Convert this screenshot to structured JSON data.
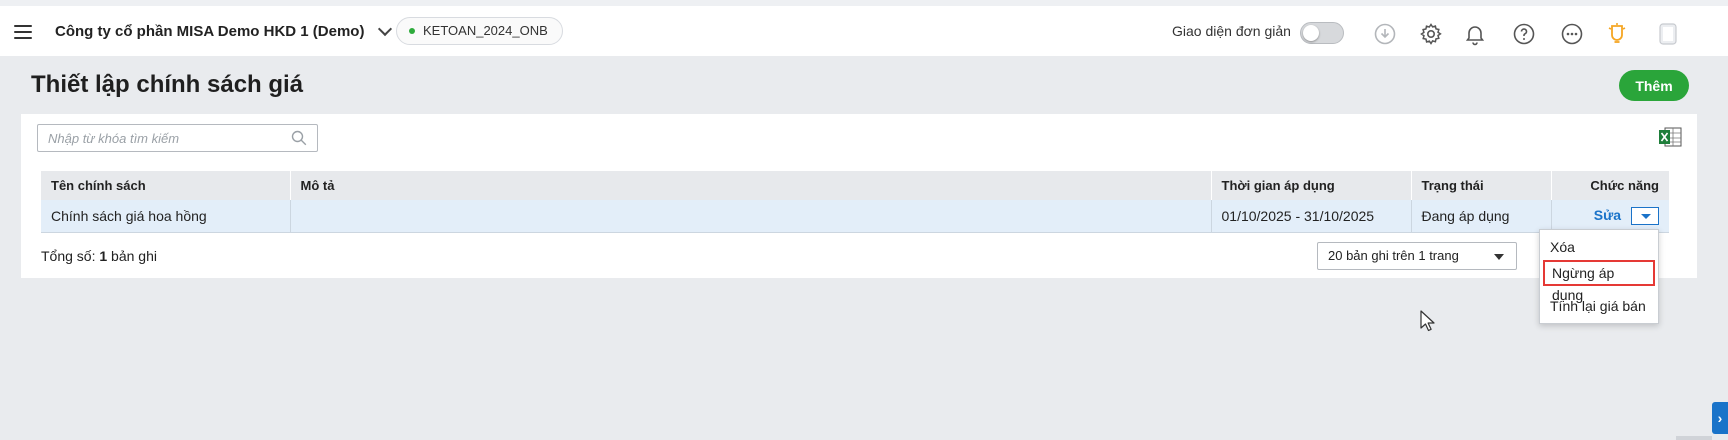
{
  "topbar": {
    "company_name": "Công ty cổ phần MISA Demo HKD 1 (Demo)",
    "database_badge": "KETOAN_2024_ONB",
    "simple_ui_label": "Giao diện đơn giản",
    "simple_ui_enabled": false
  },
  "page": {
    "title": "Thiết lập chính sách giá",
    "add_button": "Thêm"
  },
  "search": {
    "placeholder": "Nhập từ khóa tìm kiếm"
  },
  "table": {
    "headers": {
      "name": "Tên chính sách",
      "description": "Mô tả",
      "period": "Thời gian áp dụng",
      "status": "Trạng thái",
      "actions": "Chức năng"
    },
    "rows": [
      {
        "name": "Chính sách giá hoa hồng",
        "description": "",
        "period": "01/10/2025 - 31/10/2025",
        "status": "Đang áp dụng",
        "edit": "Sửa"
      }
    ]
  },
  "footer": {
    "total_prefix": "Tổng số: ",
    "total_count": "1",
    "total_suffix": " bản ghi",
    "page_size": "20 bản ghi trên 1 trang"
  },
  "action_menu": {
    "items": [
      "Xóa",
      "Ngừng áp dụng",
      "Tính lại giá bán"
    ],
    "highlighted_index": 1
  },
  "colors": {
    "primary_green": "#2aa53a",
    "link_blue": "#1a73c9",
    "highlight_red": "#e53935"
  }
}
